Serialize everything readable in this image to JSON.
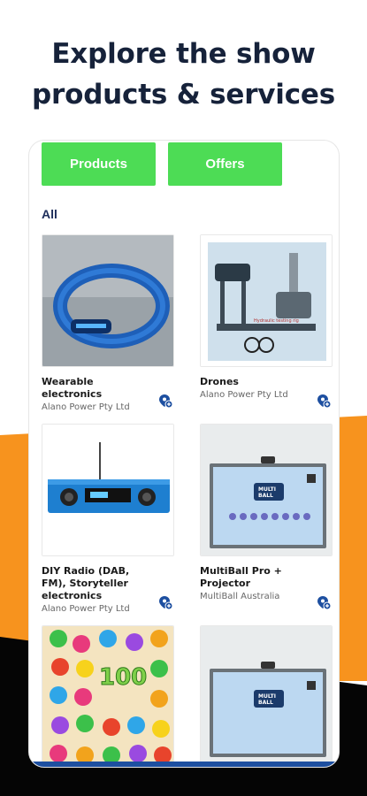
{
  "headline": {
    "line1": "Explore the show",
    "line2": "products & services"
  },
  "tabs": {
    "products": "Products",
    "offers": "Offers"
  },
  "filter": {
    "label": "All"
  },
  "products": [
    {
      "title": "Wearable electronics",
      "company": "Alano Power Pty Ltd",
      "image": "blue-led-wristband"
    },
    {
      "title": "Drones",
      "company": "Alano Power Pty Ltd",
      "image": "drone-test-rig"
    },
    {
      "title": "DIY Radio (DAB, FM), Storyteller electronics",
      "company": "Alano Power Pty Ltd",
      "image": "blue-radio-kit"
    },
    {
      "title": "MultiBall Pro + Projector",
      "company": "MultiBall Australia",
      "image": "multiball-screen"
    },
    {
      "title": "",
      "company": "",
      "image": "colorful-game-screen"
    },
    {
      "title": "",
      "company": "",
      "image": "multiball-screen"
    }
  ],
  "colors": {
    "tab_green": "#4ddc55",
    "accent_orange": "#f7931e",
    "headline_navy": "#16223a",
    "add_icon_blue": "#1d4fa0"
  },
  "icons": {
    "add_to_list": "add-location-icon"
  }
}
